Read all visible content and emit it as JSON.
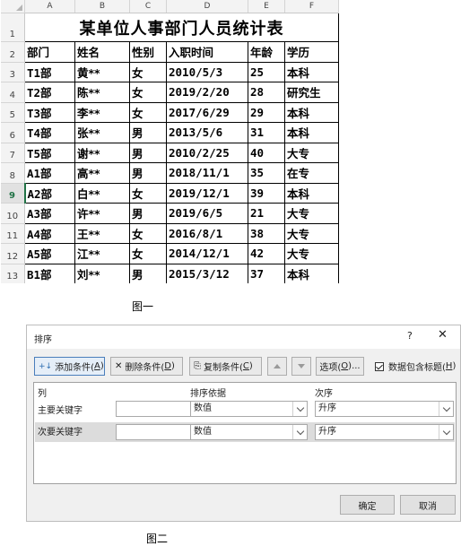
{
  "sheet": {
    "columns": [
      "A",
      "B",
      "C",
      "D",
      "E",
      "F"
    ],
    "row_numbers": [
      "1",
      "2",
      "3",
      "4",
      "5",
      "6",
      "7",
      "8",
      "9",
      "10",
      "11",
      "12",
      "13"
    ],
    "selected_row": "9",
    "title": "某单位人事部门人员统计表",
    "headers": [
      "部门",
      "姓名",
      "性别",
      "入职时间",
      "年龄",
      "学历"
    ],
    "rows": [
      [
        "T1部",
        "黄**",
        "女",
        "2010/5/3",
        "25",
        "本科"
      ],
      [
        "T2部",
        "陈**",
        "女",
        "2019/2/20",
        "28",
        "研究生"
      ],
      [
        "T3部",
        "李**",
        "女",
        "2017/6/29",
        "29",
        "本科"
      ],
      [
        "T4部",
        "张**",
        "男",
        "2013/5/6",
        "31",
        "本科"
      ],
      [
        "T5部",
        "谢**",
        "男",
        "2010/2/25",
        "40",
        "大专"
      ],
      [
        "A1部",
        "高**",
        "男",
        "2018/11/1",
        "35",
        "在专"
      ],
      [
        "A2部",
        "白**",
        "女",
        "2019/12/1",
        "39",
        "本科"
      ],
      [
        "A3部",
        "许**",
        "男",
        "2019/6/5",
        "21",
        "大专"
      ],
      [
        "A4部",
        "王**",
        "女",
        "2016/8/1",
        "38",
        "大专"
      ],
      [
        "A5部",
        "江**",
        "女",
        "2014/12/1",
        "42",
        "大专"
      ],
      [
        "B1部",
        "刘**",
        "男",
        "2015/3/12",
        "37",
        "本科"
      ]
    ]
  },
  "caption1": "图一",
  "caption2": "图二",
  "dialog": {
    "title": "排序",
    "help": "?",
    "close": "✕",
    "add_btn": {
      "icon": "+↓",
      "text": "添加条件(",
      "key": "A",
      "tail": ")"
    },
    "del_btn": {
      "icon": "✕",
      "text": "删除条件(",
      "key": "D",
      "tail": ")"
    },
    "copy_btn": {
      "icon": "⎘",
      "text": "复制条件(",
      "key": "C",
      "tail": ")"
    },
    "options_btn": {
      "text": "选项(",
      "key": "O",
      "tail": ")..."
    },
    "has_header": {
      "text": "数据包含标题(",
      "key": "H",
      "tail": ")",
      "checked": true
    },
    "grid_headers": {
      "column": "列",
      "basis": "排序依据",
      "order": "次序"
    },
    "rows": [
      {
        "label": "主要关键字",
        "column": "",
        "basis": "数值",
        "order": "升序"
      },
      {
        "label": "次要关键字",
        "column": "",
        "basis": "数值",
        "order": "升序"
      }
    ],
    "ok": "确定",
    "cancel": "取消"
  }
}
